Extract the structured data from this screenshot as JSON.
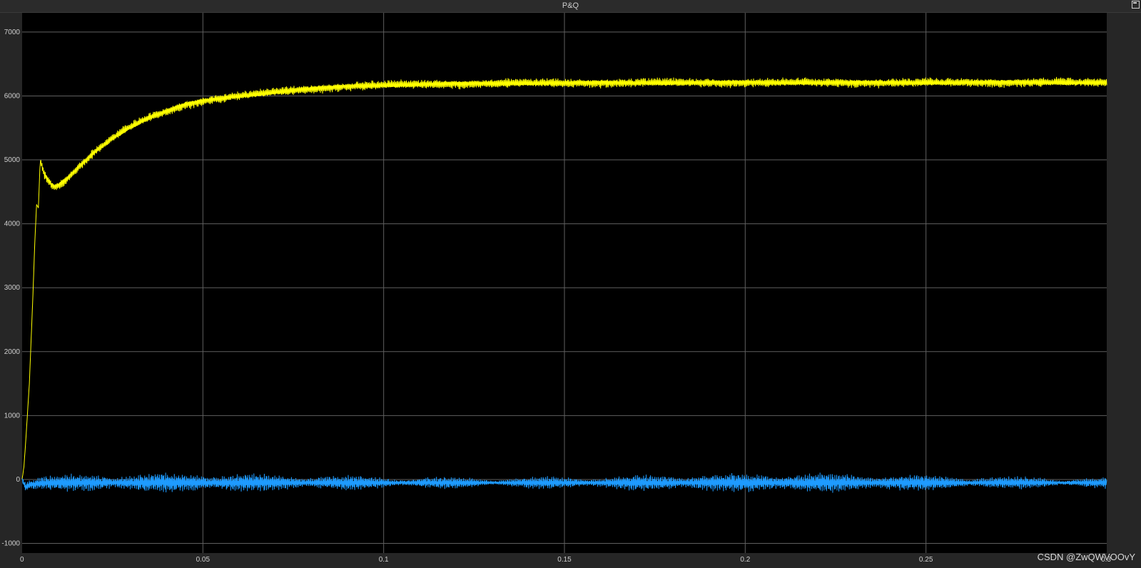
{
  "window": {
    "title": "P&Q"
  },
  "watermark": "CSDN @ZwQWVOOvY",
  "colors": {
    "background": "#000000",
    "grid": "#5f5f5f",
    "axis_text": "#cfcfcf",
    "series_p": "#ffff00",
    "series_q": "#1e9bff"
  },
  "chart_data": {
    "type": "line",
    "title": "P&Q",
    "xlabel": "",
    "ylabel": "",
    "xlim": [
      0,
      0.3
    ],
    "ylim": [
      -1150,
      7300
    ],
    "grid": true,
    "legend": "none",
    "xticks": [
      0,
      0.05,
      0.1,
      0.15,
      0.2,
      0.25,
      0.3
    ],
    "xtick_labels": [
      "0",
      "0.05",
      "0.1",
      "0.15",
      "0.2",
      "0.25",
      "0.3"
    ],
    "yticks": [
      -1000,
      0,
      1000,
      2000,
      3000,
      4000,
      5000,
      6000,
      7000
    ],
    "ytick_labels": [
      "-1000",
      "0",
      "1000",
      "2000",
      "3000",
      "4000",
      "5000",
      "6000",
      "7000"
    ],
    "series": [
      {
        "color": "#ffff00",
        "x": [
          0,
          0.0005,
          0.001,
          0.002,
          0.003,
          0.0035,
          0.004,
          0.0045,
          0.005,
          0.006,
          0.007,
          0.008,
          0.009,
          0.01,
          0.012,
          0.015,
          0.02,
          0.025,
          0.03,
          0.035,
          0.04,
          0.045,
          0.05,
          0.055,
          0.06,
          0.07,
          0.08,
          0.09,
          0.1,
          0.11,
          0.12,
          0.13,
          0.14,
          0.15,
          0.16,
          0.18,
          0.2,
          0.22,
          0.24,
          0.26,
          0.28,
          0.3
        ],
        "y": [
          0,
          200,
          600,
          1500,
          2900,
          3700,
          4300,
          4250,
          5000,
          4800,
          4700,
          4620,
          4580,
          4600,
          4680,
          4850,
          5120,
          5340,
          5520,
          5660,
          5760,
          5860,
          5920,
          5960,
          6000,
          6060,
          6110,
          6150,
          6170,
          6180,
          6190,
          6195,
          6200,
          6200,
          6205,
          6205,
          6210,
          6210,
          6205,
          6210,
          6210,
          6210
        ],
        "ripple": 70
      },
      {
        "color": "#1e9bff",
        "x": [
          0,
          0.001,
          0.002,
          0.005,
          0.01,
          0.02,
          0.04,
          0.06,
          0.08,
          0.1,
          0.15,
          0.2,
          0.25,
          0.3
        ],
        "y": [
          0,
          -120,
          -80,
          -60,
          -50,
          -50,
          -50,
          -50,
          -50,
          -50,
          -50,
          -50,
          -50,
          -50
        ],
        "ripple": 130
      }
    ]
  }
}
